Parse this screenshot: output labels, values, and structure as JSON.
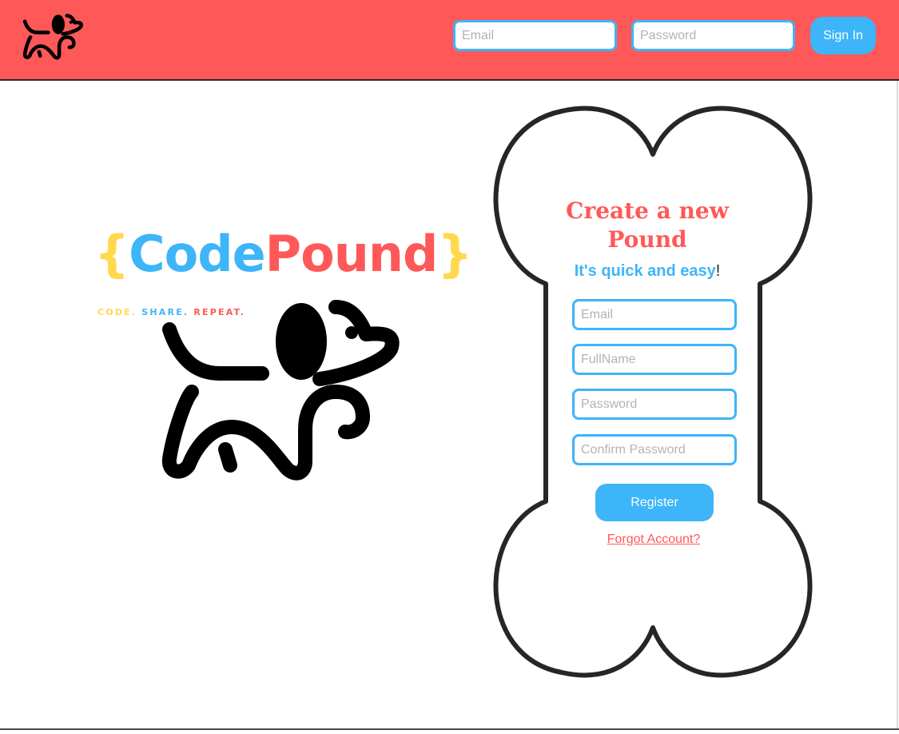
{
  "header": {
    "email_placeholder": "Email",
    "password_placeholder": "Password",
    "signin_label": "Sign In"
  },
  "brand": {
    "open_brace": "{",
    "name_part1": "Code",
    "name_part2": "Pound",
    "close_brace": "}",
    "tagline_word1": "CODE.",
    "tagline_word2": "SHARE.",
    "tagline_word3": "REPEAT."
  },
  "register": {
    "title": "Create a new Pound",
    "subtitle": "It's quick and easy",
    "subtitle_suffix": "!",
    "email_placeholder": "Email",
    "fullname_placeholder": "FullName",
    "password_placeholder": "Password",
    "confirm_placeholder": "Confirm Password",
    "register_label": "Register",
    "forgot_label": "Forgot Account?"
  },
  "icons": {
    "header_logo": "dog-icon",
    "hero_logo": "dog-icon",
    "form_background": "bone-shape"
  },
  "colors": {
    "header_bg": "#ff5858",
    "accent_blue": "#3db5f8",
    "accent_red": "#ff5858",
    "accent_yellow": "#ffd84d"
  }
}
